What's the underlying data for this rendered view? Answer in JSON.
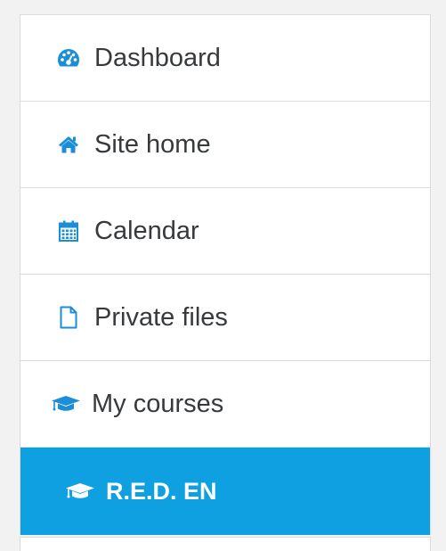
{
  "nav": {
    "items": [
      {
        "label": "Dashboard",
        "icon": "dashboard-icon"
      },
      {
        "label": "Site home",
        "icon": "home-icon"
      },
      {
        "label": "Calendar",
        "icon": "calendar-icon"
      },
      {
        "label": "Private files",
        "icon": "file-icon"
      },
      {
        "label": "My courses",
        "icon": "graduation-cap-icon"
      },
      {
        "label": "R.E.D. EN",
        "icon": "graduation-cap-icon",
        "active": true
      }
    ]
  },
  "colors": {
    "accent": "#0ea0e1",
    "icon": "#1b8ed8",
    "text": "#373a3c",
    "active_text": "#ffffff",
    "border": "#dcdcdc",
    "background": "#f2f2f2"
  }
}
